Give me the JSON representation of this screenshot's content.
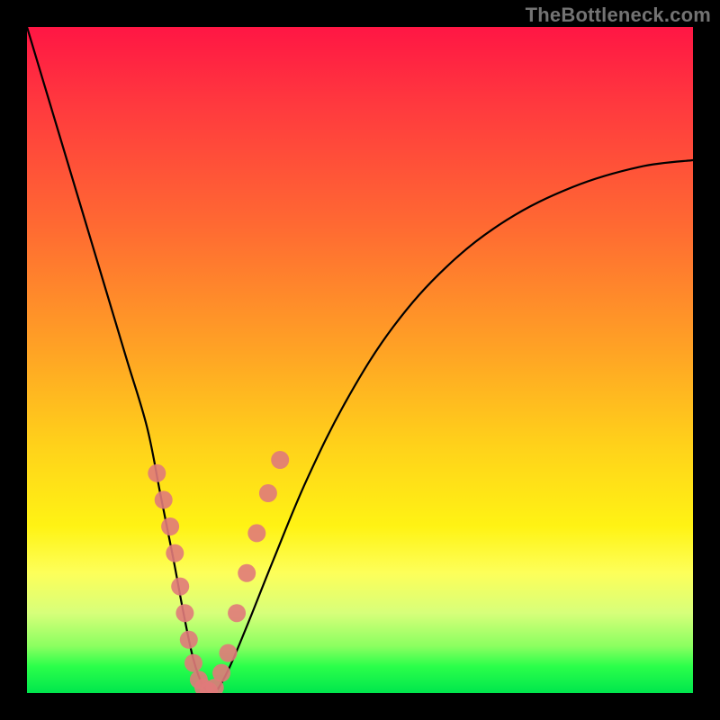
{
  "watermark": "TheBottleneck.com",
  "chart_data": {
    "type": "line",
    "title": "",
    "xlabel": "",
    "ylabel": "",
    "xlim": [
      0,
      100
    ],
    "ylim": [
      0,
      100
    ],
    "grid": false,
    "series": [
      {
        "name": "bottleneck-curve",
        "x": [
          0,
          3,
          6,
          9,
          12,
          15,
          18,
          20,
          22,
          23.5,
          25,
          26.5,
          28,
          30,
          33,
          37,
          42,
          48,
          55,
          63,
          72,
          82,
          92,
          100
        ],
        "y": [
          100,
          90,
          80,
          70,
          60,
          50,
          40,
          30,
          20,
          12,
          5,
          1,
          0,
          3,
          10,
          20,
          32,
          44,
          55,
          64,
          71,
          76,
          79,
          80
        ]
      }
    ],
    "markers": {
      "name": "highlight-dots",
      "color": "#e07a7a",
      "points": [
        {
          "x": 19.5,
          "y": 33
        },
        {
          "x": 20.5,
          "y": 29
        },
        {
          "x": 21.5,
          "y": 25
        },
        {
          "x": 22.2,
          "y": 21
        },
        {
          "x": 23.0,
          "y": 16
        },
        {
          "x": 23.7,
          "y": 12
        },
        {
          "x": 24.3,
          "y": 8
        },
        {
          "x": 25.0,
          "y": 4.5
        },
        {
          "x": 25.8,
          "y": 2
        },
        {
          "x": 26.5,
          "y": 0.8
        },
        {
          "x": 27.3,
          "y": 0.3
        },
        {
          "x": 28.2,
          "y": 0.8
        },
        {
          "x": 29.2,
          "y": 3
        },
        {
          "x": 30.2,
          "y": 6
        },
        {
          "x": 31.5,
          "y": 12
        },
        {
          "x": 33.0,
          "y": 18
        },
        {
          "x": 34.5,
          "y": 24
        },
        {
          "x": 36.2,
          "y": 30
        },
        {
          "x": 38.0,
          "y": 35
        }
      ]
    },
    "background_gradient": {
      "top": "#ff1644",
      "upper_mid": "#ffa125",
      "mid": "#fff314",
      "lower_mid": "#8aff60",
      "bottom": "#00e64d"
    }
  }
}
